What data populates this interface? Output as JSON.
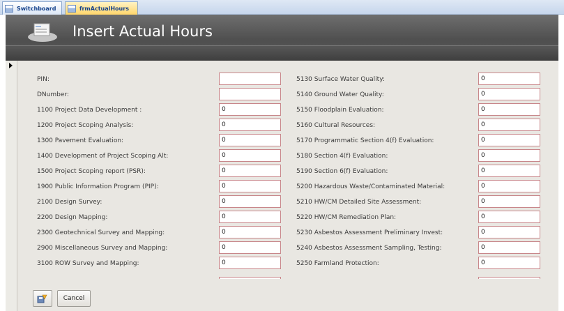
{
  "tabs": [
    {
      "label": "Switchboard",
      "icon": "form-icon"
    },
    {
      "label": "frmActualHours",
      "icon": "form-icon",
      "active": true
    }
  ],
  "header": {
    "title": "Insert Actual Hours",
    "icon": "form-icon"
  },
  "left_fields": [
    {
      "label": "PIN:",
      "value": ""
    },
    {
      "label": "DNumber:",
      "value": ""
    },
    {
      "label": "1100 Project Data Development :",
      "value": "0"
    },
    {
      "label": "1200 Project Scoping Analysis:",
      "value": "0"
    },
    {
      "label": "1300 Pavement Evaluation:",
      "value": "0"
    },
    {
      "label": "1400 Development of Project Scoping Alt:",
      "value": "0"
    },
    {
      "label": "1500 Project Scoping report (PSR):",
      "value": "0"
    },
    {
      "label": "1900 Public Information Program (PIP):",
      "value": "0"
    },
    {
      "label": "2100 Design Survey:",
      "value": "0"
    },
    {
      "label": "2200 Design Mapping:",
      "value": "0"
    },
    {
      "label": "2300 Geotechnical Survey and Mapping:",
      "value": "0"
    },
    {
      "label": "2900 Miscellaneous Survey and Mapping:",
      "value": "0"
    },
    {
      "label": "3100 ROW Survey and Mapping:",
      "value": "0"
    }
  ],
  "right_fields": [
    {
      "label": "5130 Surface Water Quality:",
      "value": "0"
    },
    {
      "label": "5140 Ground Water Quality:",
      "value": "0"
    },
    {
      "label": "5150 Floodplain Evaluation:",
      "value": "0"
    },
    {
      "label": "5160 Cultural Resources:",
      "value": "0"
    },
    {
      "label": "5170 Programmatic Section 4(f) Evaluation:",
      "value": "0"
    },
    {
      "label": "5180 Section 4(f) Evaluation:",
      "value": "0"
    },
    {
      "label": "5190 Section 6(f) Evaluation:",
      "value": "0"
    },
    {
      "label": "5200 Hazardous Waste/Contaminated Material:",
      "value": "0"
    },
    {
      "label": "5210 HW/CM Detailed Site Assessment:",
      "value": "0"
    },
    {
      "label": "5220 HW/CM Remediation Plan:",
      "value": "0"
    },
    {
      "label": "5230 Asbestos Assessment Preliminary Invest:",
      "value": "0"
    },
    {
      "label": "5240 Asbestos Assessment Sampling, Testing:",
      "value": "0"
    },
    {
      "label": "5250 Farmland Protection:",
      "value": "0"
    }
  ],
  "buttons": {
    "save_icon": "save-icon",
    "cancel_label": "Cancel"
  },
  "colors": {
    "input_border": "#c8868a",
    "active_tab": "#ffd66b",
    "header": "#555555",
    "form_background": "#e9e7e2"
  }
}
